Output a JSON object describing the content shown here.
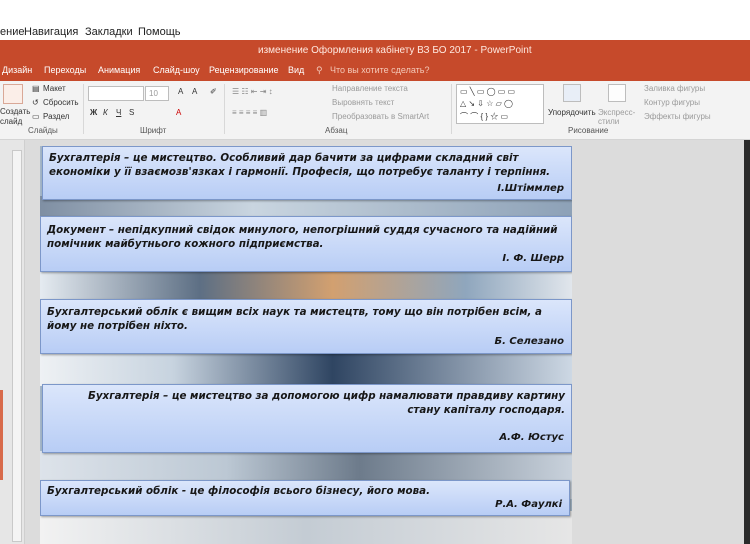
{
  "menubar": {
    "items": [
      "ение",
      "Навигация",
      "Закладки",
      "Помощь"
    ]
  },
  "window": {
    "title": "изменение Оформления кабінету ВЗ БО 2017  -  PowerPoint"
  },
  "ribbon_tabs": [
    "Дизайн",
    "Переходы",
    "Анимация",
    "Слайд-шоу",
    "Рецензирование",
    "Вид"
  ],
  "tell_me": "Что вы хотите сделать?",
  "ribbon": {
    "create": "Создать",
    "slide": "слайд",
    "layout": "Макет",
    "reset": "Сбросить",
    "section": "Раздел",
    "font_size": "10",
    "bold": "Ж",
    "italic": "К",
    "underline": "Ч",
    "strike": "S",
    "text_direction": "Направление текста",
    "align_text": "Выровнять текст",
    "smartart": "Преобразовать в SmartArt",
    "arrange": "Упорядочить",
    "quick_styles": "Экспресс-стили",
    "shape_fill": "Заливка фигуры",
    "shape_outline": "Контур фигуры",
    "shape_effects": "Эффекты фигуры",
    "groups": {
      "slides": "Слайды",
      "font": "Шрифт",
      "paragraph": "Абзац",
      "drawing": "Рисование"
    }
  },
  "quotes": [
    {
      "text": "Бухгалтерія – це мистецтво. Особливий дар бачити за цифрами складний світ економіки у її взаємозв'язках і гармонії. Професія, що потребує таланту і терпіння.",
      "author": "І.Штіммлер"
    },
    {
      "text": "Документ – непідкупний свідок минулого, непогрішний суддя сучасного та надійний помічник майбутнього кожного підприємства.",
      "author": "І. Ф. Шерр"
    },
    {
      "text": "Бухгалтерський облік є вищим всіх наук та мистецтв, тому що він потрібен всім, а йому не потрібен ніхто.",
      "author": "Б. Селезано"
    },
    {
      "text": "Бухгалтерія – це мистецтво за допомогою цифр намалювати правдиву картину стану капіталу господаря.",
      "author": "А.Ф. Юстус"
    },
    {
      "text": "Бухгалтерський облік -  це філософія всього бізнесу,  його мова.",
      "author": "Р.А. Фаулкі"
    }
  ],
  "colors": {
    "accent": "#c64a2b",
    "quote_fill": "#c8d8f8",
    "quote_border": "#7c97c9"
  }
}
